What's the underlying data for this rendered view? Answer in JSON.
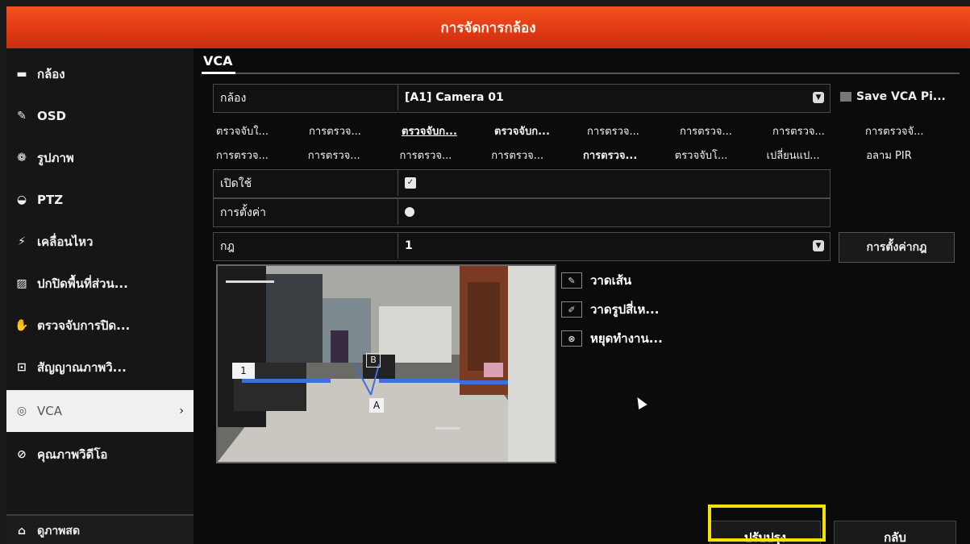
{
  "window": {
    "title": "การจัดการกล้อง"
  },
  "sidebar": {
    "items": [
      {
        "label": "กล้อง",
        "icon": "camera-icon"
      },
      {
        "label": "OSD",
        "icon": "brush-icon"
      },
      {
        "label": "รูปภาพ",
        "icon": "palette-icon"
      },
      {
        "label": "PTZ",
        "icon": "ptz-icon"
      },
      {
        "label": "เคลื่อนไหว",
        "icon": "motion-icon"
      },
      {
        "label": "ปกปิดพื้นที่ส่วน...",
        "icon": "mask-icon"
      },
      {
        "label": "ตรวจจับการปิด...",
        "icon": "tamper-icon"
      },
      {
        "label": "สัญญาณภาพวิ...",
        "icon": "video-loss-icon"
      },
      {
        "label": "VCA",
        "icon": "vca-icon",
        "active": true
      },
      {
        "label": "คุณภาพวิดีโอ",
        "icon": "quality-icon"
      }
    ],
    "live_label": "ดูภาพสด"
  },
  "main": {
    "tab": "VCA",
    "camera_label": "กล้อง",
    "camera_value": "[A1] Camera 01",
    "save_vca_label": "Save VCA Pi...",
    "detection_types_row1": [
      "ตรวจจับใ...",
      "การตรวจ...",
      "ตรวจจับก...",
      "ตรวจจับก...",
      "การตรวจ...",
      "การตรวจ...",
      "การตรวจ...",
      "การตรวจจั..."
    ],
    "detection_types_row2": [
      "การตรวจ...",
      "การตรวจ...",
      "การตรวจ...",
      "การตรวจ...",
      "การตรวจ...",
      "ตรวจจับโ...",
      "เปลี่ยนแป...",
      "อลาม PIR"
    ],
    "enable_label": "เปิดใช้",
    "enable_checked": true,
    "settings_label": "การตั้งค่า",
    "rule_label": "กฎ",
    "rule_value": "1",
    "rule_settings_button": "การตั้งค่ากฎ",
    "tools": [
      "วาดเส้น",
      "วาดรูปสี่เห...",
      "หยุดทำงาน..."
    ],
    "preview": {
      "markers": [
        "1",
        "A",
        "B"
      ]
    }
  },
  "footer": {
    "apply_button": "ปรับปรุง",
    "back_button": "กลับ"
  },
  "colors": {
    "title_bar": "#e23a14",
    "highlight": "#f2e400",
    "detection_line": "#3f6fd8"
  }
}
